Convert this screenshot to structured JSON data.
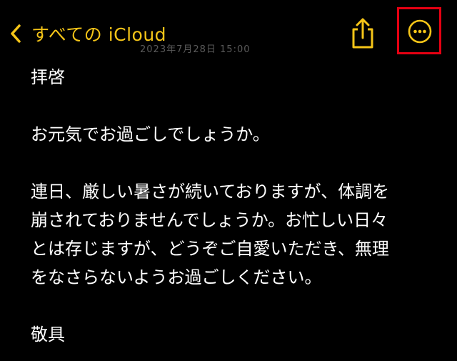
{
  "nav": {
    "back_label": "すべての iCloud",
    "date_text": "2023年7月28日 15:00",
    "accent_color": "#F5C518",
    "highlight_color": "#E50012",
    "icons": {
      "back": "chevron-left-icon",
      "share": "share-icon",
      "more": "ellipsis-circle-icon"
    }
  },
  "note": {
    "salutation": "拝啓",
    "greeting": "お元気でお過ごしでしょうか。",
    "paragraph_lines": [
      "連日、厳しい暑さが続いておりますが、体調を",
      "崩されておりませんでしょうか。お忙しい日々",
      "とは存じますが、どうぞご自愛いただき、無理",
      "をなさらないようお過ごしください。"
    ],
    "closing": "敬具"
  }
}
